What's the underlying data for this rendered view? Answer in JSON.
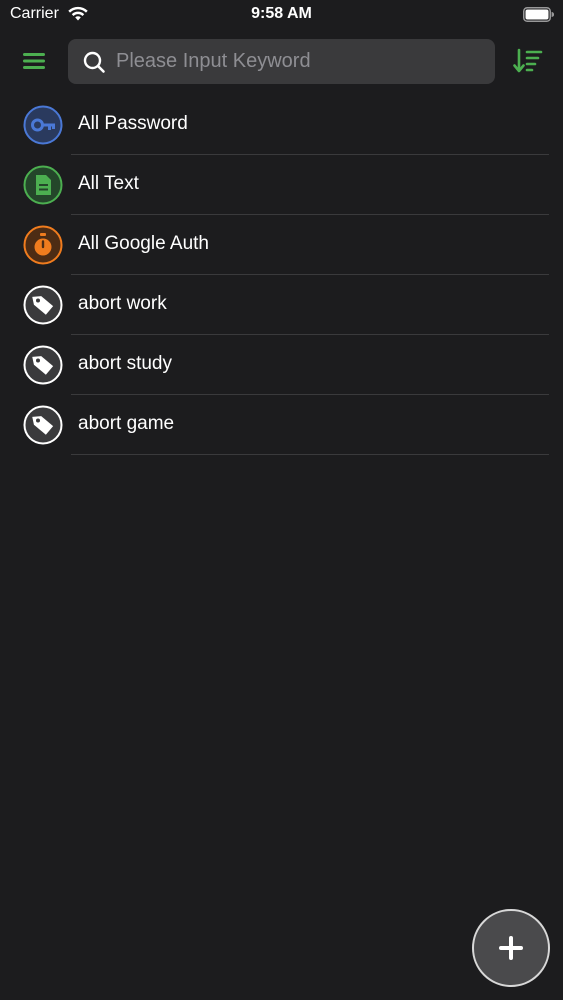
{
  "status_bar": {
    "carrier": "Carrier",
    "time": "9:58 AM"
  },
  "header": {
    "menu_icon": "hamburger-menu-icon",
    "search": {
      "placeholder": "Please Input Keyword",
      "value": ""
    },
    "sort_icon": "sort-descending-icon"
  },
  "colors": {
    "background": "#1c1c1e",
    "accent_green": "#4caf50",
    "password_blue": "#4a78d6",
    "text_green": "#4caf50",
    "auth_orange": "#f07c1e",
    "tag_gray": "#3a3a3c",
    "divider": "#3a3a3c"
  },
  "list": {
    "items": [
      {
        "label": "All Password",
        "icon": "key-icon"
      },
      {
        "label": "All Text",
        "icon": "document-icon"
      },
      {
        "label": "All Google Auth",
        "icon": "stopwatch-icon"
      },
      {
        "label": "abort work",
        "icon": "tag-icon"
      },
      {
        "label": "abort study",
        "icon": "tag-icon"
      },
      {
        "label": "abort game",
        "icon": "tag-icon"
      }
    ]
  },
  "fab": {
    "icon": "plus-icon"
  }
}
